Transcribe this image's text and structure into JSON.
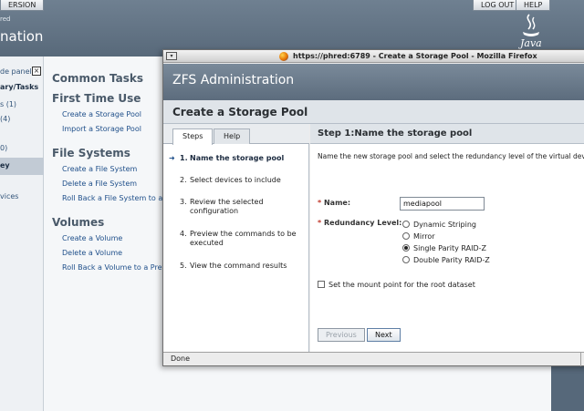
{
  "console": {
    "version_button": "ERSION",
    "logout_button": "LOG OUT",
    "help_button": "HELP",
    "subtitle": "red",
    "title": "nation",
    "java_logo_text": "Java"
  },
  "left_panel": {
    "hide_label": "de panel",
    "items": [
      "ary/Tasks",
      "s (1)",
      "(4)",
      "0)",
      "ey",
      "vices"
    ]
  },
  "tasks": {
    "heading": "Common Tasks",
    "sections": [
      {
        "title": "First Time Use",
        "links": [
          "Create a Storage Pool",
          "Import a Storage Pool"
        ]
      },
      {
        "title": "File Systems",
        "links": [
          "Create a File System",
          "Delete a File System",
          "Roll Back a File System to a P"
        ]
      },
      {
        "title": "Volumes",
        "links": [
          "Create a Volume",
          "Delete a Volume",
          "Roll Back a Volume to a Prev"
        ]
      }
    ]
  },
  "browser": {
    "window_title": "https://phred:6789 - Create a Storage Pool - Mozilla Firefox",
    "status": "Done"
  },
  "wizard": {
    "app_title": "ZFS Administration",
    "page_title": "Create a Storage Pool",
    "tabs": [
      "Steps",
      "Help"
    ],
    "steps": [
      {
        "num": "1.",
        "label": "Name the storage pool"
      },
      {
        "num": "2.",
        "label": "Select devices to include"
      },
      {
        "num": "3.",
        "label": "Review the selected configuration"
      },
      {
        "num": "4.",
        "label": "Preview the commands to be executed"
      },
      {
        "num": "5.",
        "label": "View the command results"
      }
    ],
    "current_step_index": 0,
    "step_header": "Step 1:Name the storage pool",
    "instructions": "Name the new storage pool and select the redundancy level of the virtual devi",
    "name_label": "Name:",
    "name_value": "mediapool",
    "redundancy_label": "Redundancy Level:",
    "redundancy_options": [
      "Dynamic Striping",
      "Mirror",
      "Single Parity RAID-Z",
      "Double Parity RAID-Z"
    ],
    "redundancy_selected": "Single Parity RAID-Z",
    "mount_checkbox_label": "Set the mount point for the root dataset",
    "previous_button": "Previous",
    "next_button": "Next"
  }
}
